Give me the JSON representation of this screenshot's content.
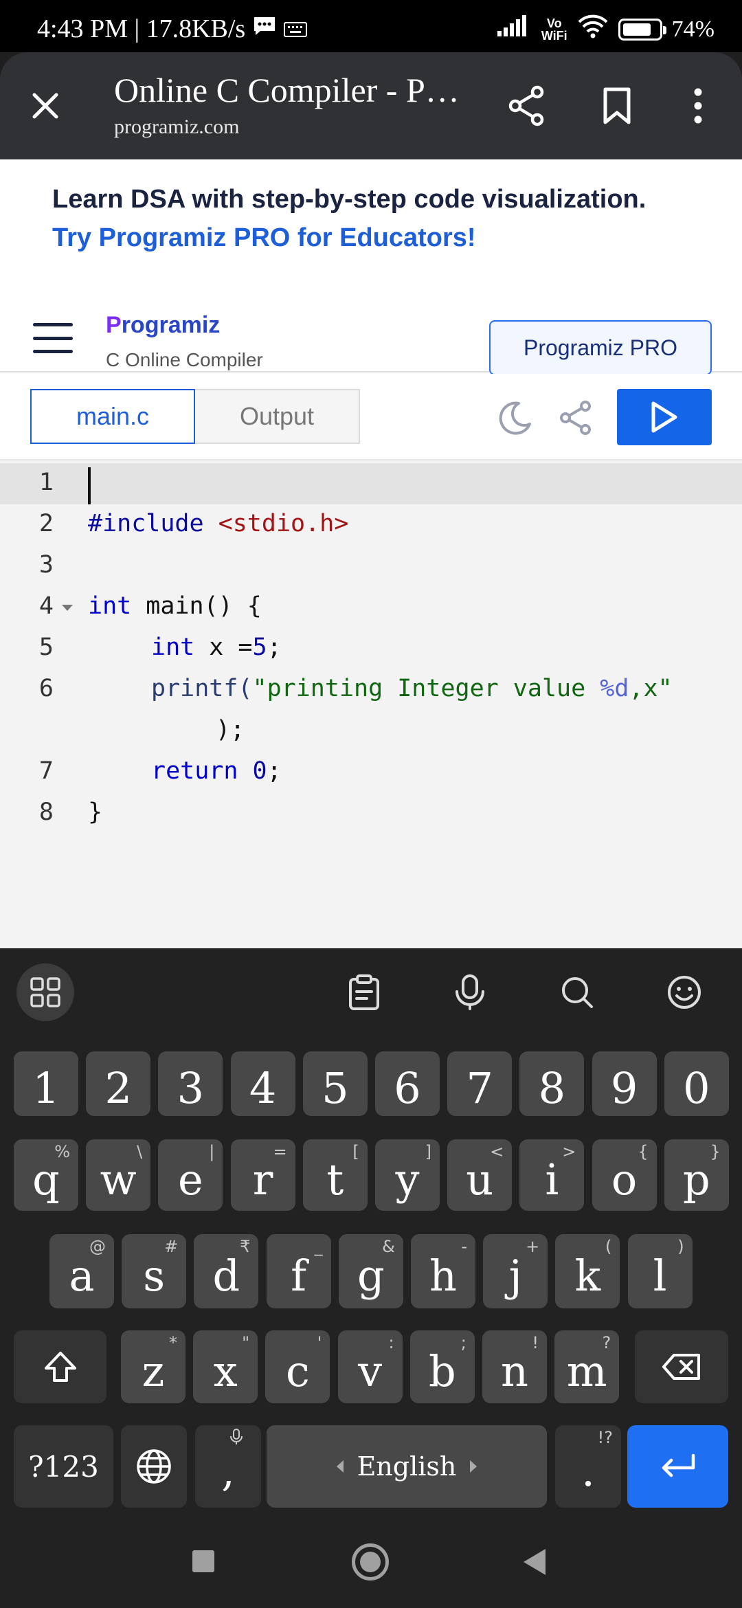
{
  "status_bar": {
    "time_speed": "4:43 PM | 17.8KB/s",
    "vowifi_top": "Vo",
    "vowifi_bottom": "WiFi",
    "battery": "74%"
  },
  "browser": {
    "title": "Online C Compiler - P…",
    "url": "programiz.com"
  },
  "promo": {
    "line1": "Learn DSA with step-by-step code visualization.",
    "line2": "Try Programiz PRO for Educators!"
  },
  "site": {
    "logo_mark": "P",
    "logo_rest": "rogramiz",
    "subtitle": "C Online Compiler",
    "pro_button": "Programiz PRO"
  },
  "editor_tabs": {
    "main": "main.c",
    "output": "Output"
  },
  "code": {
    "line_numbers": [
      "1",
      "2",
      "3",
      "4",
      "5",
      "6",
      "7",
      "8"
    ],
    "l2_a": "#include ",
    "l2_b": "<stdio.h>",
    "l4_a": "int",
    "l4_b": " main() {",
    "l5_a": "int",
    "l5_b": " x =",
    "l5_c": "5",
    "l5_d": ";",
    "l6_a": "printf(",
    "l6_b": "\"printing Integer value ",
    "l6_c": "%d",
    "l6_d": ",x\"",
    "l6_wrap": ");",
    "l7_a": "return",
    "l7_b": " ",
    "l7_c": "0",
    "l7_d": ";",
    "l8": "}"
  },
  "keyboard": {
    "numbers": [
      "1",
      "2",
      "3",
      "4",
      "5",
      "6",
      "7",
      "8",
      "9",
      "0"
    ],
    "row1": [
      "q",
      "w",
      "e",
      "r",
      "t",
      "y",
      "u",
      "i",
      "o",
      "p"
    ],
    "row1_hints": [
      "%",
      "\\",
      "|",
      "=",
      "[",
      "]",
      "<",
      ">",
      "{",
      "}"
    ],
    "row2": [
      "a",
      "s",
      "d",
      "f",
      "g",
      "h",
      "j",
      "k",
      "l"
    ],
    "row2_hints": [
      "@",
      "#",
      "₹",
      "_",
      "&",
      "-",
      "+",
      "(",
      ")"
    ],
    "row3": [
      "z",
      "x",
      "c",
      "v",
      "b",
      "n",
      "m"
    ],
    "row3_hints": [
      "*",
      "\"",
      "'",
      ":",
      ";",
      "!",
      "?"
    ],
    "symbols": "?123",
    "comma": ",",
    "space": "English",
    "period": ".",
    "period_hint": "!?"
  }
}
